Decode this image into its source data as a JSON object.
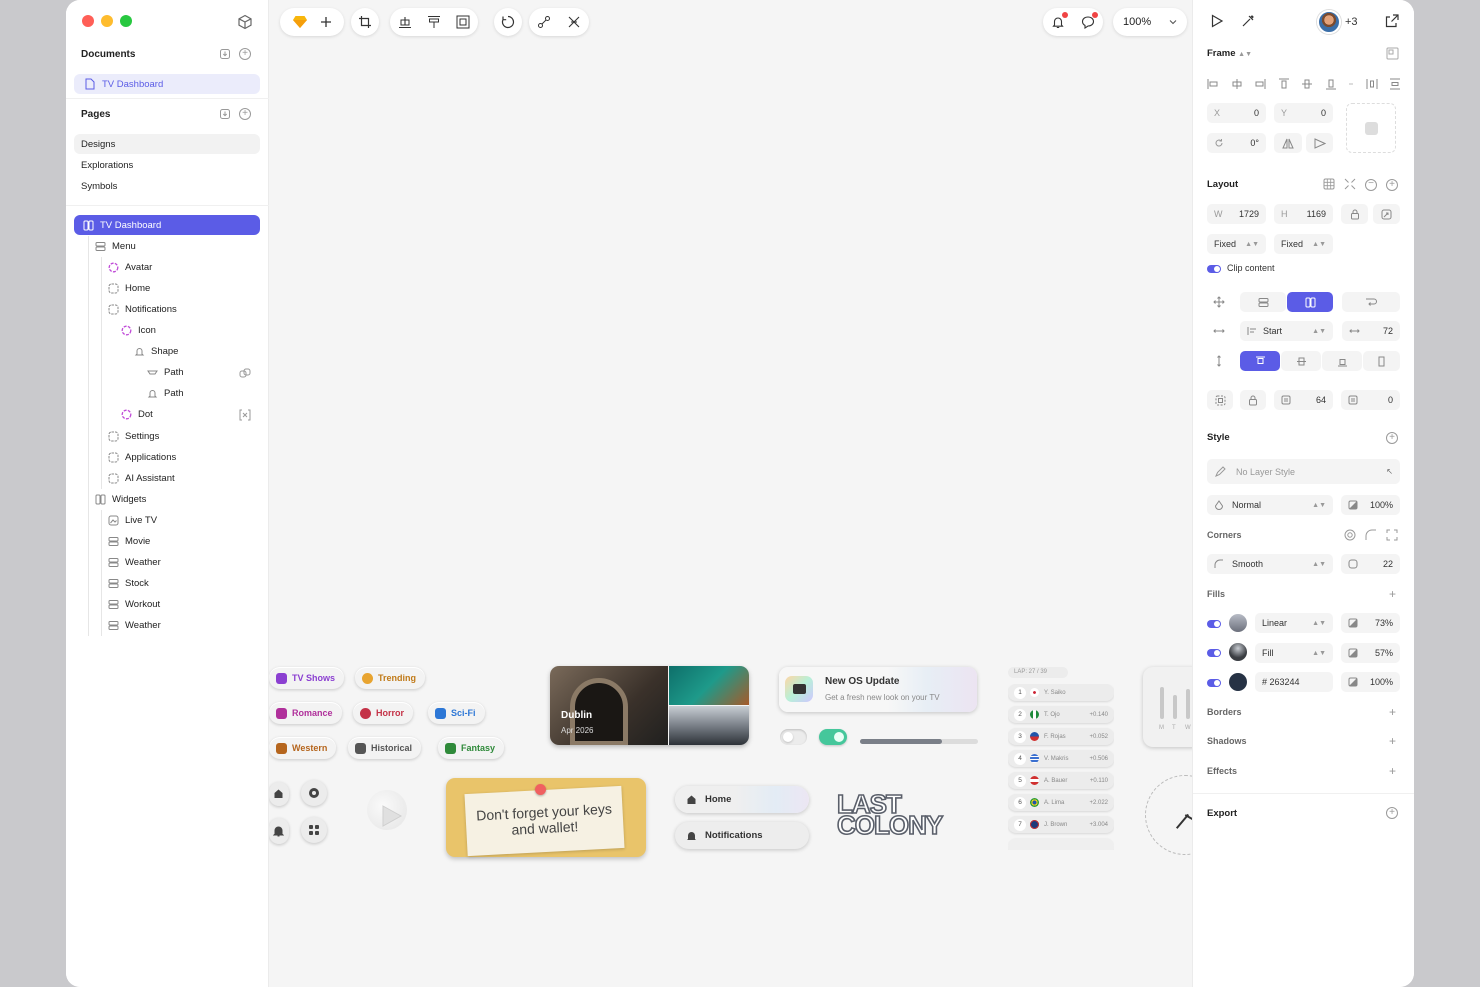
{
  "sidebar": {
    "documents_title": "Documents",
    "document_item": "TV Dashboard",
    "pages_title": "Pages",
    "pages": [
      "Designs",
      "Explorations",
      "Symbols"
    ],
    "layers": [
      {
        "label": "TV Dashboard",
        "icon": "frame-icon"
      },
      {
        "label": "Menu",
        "icon": "stack-icon"
      },
      {
        "label": "Avatar",
        "icon": "component-icon"
      },
      {
        "label": "Home",
        "icon": "symbol-icon"
      },
      {
        "label": "Notifications",
        "icon": "symbol-icon"
      },
      {
        "label": "Icon",
        "icon": "component-icon"
      },
      {
        "label": "Shape",
        "icon": "bell-shape-icon"
      },
      {
        "label": "Path",
        "icon": "path-icon"
      },
      {
        "label": "Path",
        "icon": "bell-path-icon"
      },
      {
        "label": "Dot",
        "icon": "component-icon"
      },
      {
        "label": "Settings",
        "icon": "symbol-icon"
      },
      {
        "label": "Applications",
        "icon": "symbol-icon"
      },
      {
        "label": "AI Assistant",
        "icon": "symbol-icon"
      },
      {
        "label": "Widgets",
        "icon": "frame-icon"
      },
      {
        "label": "Live TV",
        "icon": "image-icon"
      },
      {
        "label": "Movie",
        "icon": "stack-icon"
      },
      {
        "label": "Weather",
        "icon": "stack-icon"
      },
      {
        "label": "Stock",
        "icon": "stack-icon"
      },
      {
        "label": "Workout",
        "icon": "stack-icon"
      },
      {
        "label": "Weather",
        "icon": "stack-icon"
      }
    ]
  },
  "toolbar": {
    "zoom": "100%",
    "collaborators_extra": "+3"
  },
  "canvas": {
    "chips": [
      {
        "label": "TV Shows",
        "color": "#8b3fd1"
      },
      {
        "label": "Trending",
        "color": "#d99a2b"
      },
      {
        "label": "Romance",
        "color": "#b0309b"
      },
      {
        "label": "Horror",
        "color": "#c43247"
      },
      {
        "label": "Sci-Fi",
        "color": "#2d77d6"
      },
      {
        "label": "Western",
        "color": "#b5651d"
      },
      {
        "label": "Historical",
        "color": "#555555"
      },
      {
        "label": "Fantasy",
        "color": "#2f8a3a"
      }
    ],
    "travel_card": {
      "city": "Dublin",
      "date": "Apr 2026"
    },
    "os_update": {
      "title": "New OS Update",
      "subtitle": "Get a fresh new look on your TV"
    },
    "sticky_note": "Don't forget your keys and wallet!",
    "menu_pills": [
      "Home",
      "Notifications"
    ],
    "logo_text": "LAST COLONY",
    "leaderboard": {
      "header": "LAP: 27 / 39",
      "rows": [
        {
          "pos": "1",
          "name": "Y. Saiko",
          "delta": "",
          "flag": "#cc2233"
        },
        {
          "pos": "2",
          "name": "T. Ojo",
          "delta": "+0.140",
          "flag": "#1e8a3a"
        },
        {
          "pos": "3",
          "name": "F. Rojas",
          "delta": "+0.052",
          "flag": "#2255aa"
        },
        {
          "pos": "4",
          "name": "V. Makris",
          "delta": "+0.506",
          "flag": "#3a6fd0"
        },
        {
          "pos": "5",
          "name": "A. Bauer",
          "delta": "+0.110",
          "flag": "#d03030"
        },
        {
          "pos": "6",
          "name": "A. Lima",
          "delta": "+2.022",
          "flag": "#2a9d3a"
        },
        {
          "pos": "7",
          "name": "J. Brown",
          "delta": "+3.004",
          "flag": "#1f3a7a"
        }
      ]
    },
    "workout_days": [
      "M",
      "T",
      "W"
    ]
  },
  "inspector": {
    "frame_title": "Frame",
    "x_label": "X",
    "x_value": "0",
    "y_label": "Y",
    "y_value": "0",
    "rotation": "0°",
    "layout_title": "Layout",
    "w_label": "W",
    "w_value": "1729",
    "h_label": "H",
    "h_value": "1169",
    "sizing_w": "Fixed",
    "sizing_h": "Fixed",
    "clip_content": "Clip content",
    "align": "Start",
    "gap": "72",
    "padding": "64",
    "padding2": "0",
    "style_title": "Style",
    "layer_style": "No Layer Style",
    "blend_mode": "Normal",
    "opacity": "100%",
    "corners_title": "Corners",
    "corner_style": "Smooth",
    "corner_radius": "22",
    "fills_title": "Fills",
    "fills": [
      {
        "type": "Linear",
        "opacity": "73%",
        "color": "#8c8f99"
      },
      {
        "type": "Fill",
        "opacity": "57%",
        "color": "#3a3d42"
      },
      {
        "type": "# 263244",
        "opacity": "100%",
        "color": "#263244"
      }
    ],
    "borders_title": "Borders",
    "shadows_title": "Shadows",
    "effects_title": "Effects",
    "export_title": "Export",
    "accent": "#5b5ce6"
  }
}
